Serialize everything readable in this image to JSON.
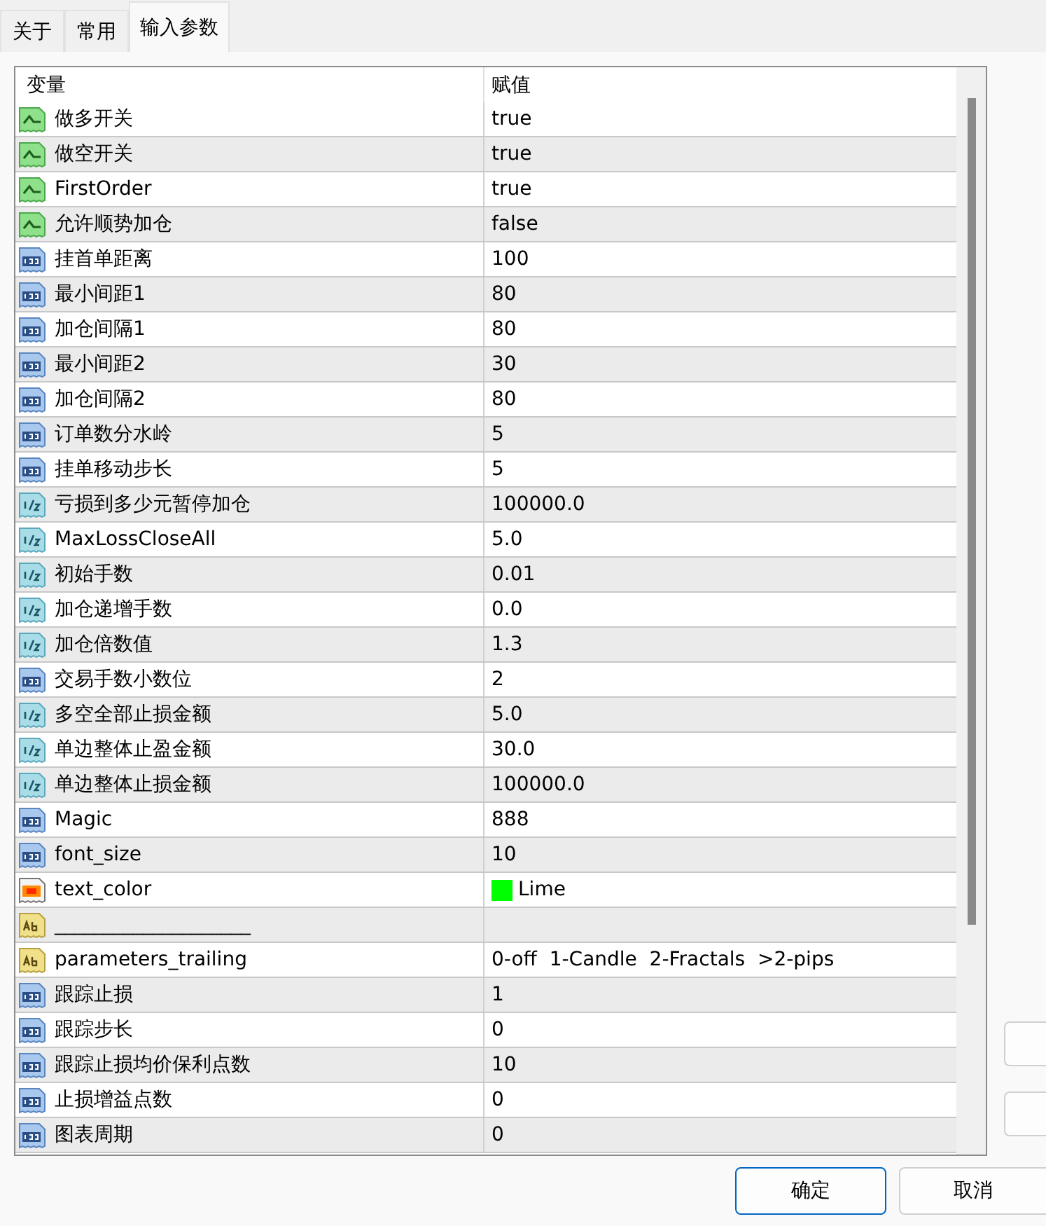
{
  "tabs": [
    {
      "label": "关于",
      "selected": false
    },
    {
      "label": "常用",
      "selected": false
    },
    {
      "label": "输入参数",
      "selected": true
    }
  ],
  "table": {
    "columns": [
      "变量",
      "赋值"
    ],
    "rows": [
      {
        "kind": "bool",
        "name": "做多开关",
        "value": "true"
      },
      {
        "kind": "bool",
        "name": "做空开关",
        "value": "true"
      },
      {
        "kind": "bool",
        "name": "FirstOrder",
        "value": "true"
      },
      {
        "kind": "bool",
        "name": "允许顺势加仓",
        "value": "false"
      },
      {
        "kind": "int",
        "name": "挂首单距离",
        "value": "100"
      },
      {
        "kind": "int",
        "name": "最小间距1",
        "value": "80"
      },
      {
        "kind": "int",
        "name": "加仓间隔1",
        "value": "80"
      },
      {
        "kind": "int",
        "name": "最小间距2",
        "value": "30"
      },
      {
        "kind": "int",
        "name": "加仓间隔2",
        "value": "80"
      },
      {
        "kind": "int",
        "name": "订单数分水岭",
        "value": "5"
      },
      {
        "kind": "int",
        "name": "挂单移动步长",
        "value": "5"
      },
      {
        "kind": "double",
        "name": "亏损到多少元暂停加仓",
        "value": "100000.0"
      },
      {
        "kind": "double",
        "name": "MaxLossCloseAll",
        "value": "5.0"
      },
      {
        "kind": "double",
        "name": "初始手数",
        "value": "0.01"
      },
      {
        "kind": "double",
        "name": "加仓递增手数",
        "value": "0.0"
      },
      {
        "kind": "double",
        "name": "加仓倍数值",
        "value": "1.3"
      },
      {
        "kind": "int",
        "name": "交易手数小数位",
        "value": "2"
      },
      {
        "kind": "double",
        "name": "多空全部止损金额",
        "value": "5.0"
      },
      {
        "kind": "double",
        "name": "单边整体止盈金额",
        "value": "30.0"
      },
      {
        "kind": "double",
        "name": "单边整体止损金额",
        "value": "100000.0"
      },
      {
        "kind": "int",
        "name": "Magic",
        "value": "888"
      },
      {
        "kind": "int",
        "name": "font_size",
        "value": "10"
      },
      {
        "kind": "color",
        "name": "text_color",
        "value": "Lime",
        "color": "#00ff00"
      },
      {
        "kind": "string",
        "name": "____________________"
      },
      {
        "kind": "string",
        "name": "parameters_trailing",
        "value": "0-off  1-Candle  2-Fractals  >2-pips"
      },
      {
        "kind": "int",
        "name": "跟踪止损",
        "value": "1"
      },
      {
        "kind": "int",
        "name": "跟踪步长",
        "value": "0"
      },
      {
        "kind": "int",
        "name": "跟踪止损均价保利点数",
        "value": "10"
      },
      {
        "kind": "int",
        "name": "止损增益点数",
        "value": "0"
      },
      {
        "kind": "int",
        "name": "图表周期",
        "value": "0"
      }
    ]
  },
  "buttons": [
    "确定",
    "取消"
  ]
}
